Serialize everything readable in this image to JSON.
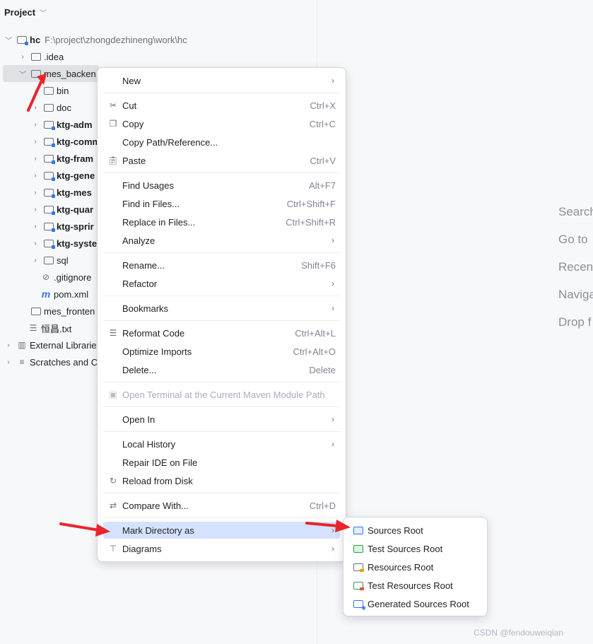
{
  "project_panel": {
    "title": "Project",
    "tree": [
      {
        "name": "hc",
        "path": "F:\\project\\zhongdezhineng\\work\\hc"
      },
      {
        "name": ".idea"
      },
      {
        "name": "mes_backen"
      },
      {
        "name": "bin"
      },
      {
        "name": "doc"
      },
      {
        "name": "ktg-adm"
      },
      {
        "name": "ktg-comm"
      },
      {
        "name": "ktg-fram"
      },
      {
        "name": "ktg-gene"
      },
      {
        "name": "ktg-mes"
      },
      {
        "name": "ktg-quar"
      },
      {
        "name": "ktg-sprir"
      },
      {
        "name": "ktg-syste"
      },
      {
        "name": "sql"
      },
      {
        "name": ".gitignore"
      },
      {
        "name": "pom.xml"
      },
      {
        "name": "mes_fronten"
      },
      {
        "name": "恒昌.txt"
      },
      {
        "name": "External Librarie"
      },
      {
        "name": "Scratches and C"
      }
    ]
  },
  "editor_hints": [
    "Search",
    "Go to",
    "Recent",
    "Naviga",
    "Drop f"
  ],
  "context_menu": {
    "items": [
      {
        "label": "New",
        "shortcut": ""
      },
      {
        "label": "Cut",
        "shortcut": "Ctrl+X"
      },
      {
        "label": "Copy",
        "shortcut": "Ctrl+C"
      },
      {
        "label": "Copy Path/Reference...",
        "shortcut": ""
      },
      {
        "label": "Paste",
        "shortcut": "Ctrl+V"
      },
      {
        "label": "Find Usages",
        "shortcut": "Alt+F7"
      },
      {
        "label": "Find in Files...",
        "shortcut": "Ctrl+Shift+F"
      },
      {
        "label": "Replace in Files...",
        "shortcut": "Ctrl+Shift+R"
      },
      {
        "label": "Analyze",
        "shortcut": ""
      },
      {
        "label": "Rename...",
        "shortcut": "Shift+F6"
      },
      {
        "label": "Refactor",
        "shortcut": ""
      },
      {
        "label": "Bookmarks",
        "shortcut": ""
      },
      {
        "label": "Reformat Code",
        "shortcut": "Ctrl+Alt+L"
      },
      {
        "label": "Optimize Imports",
        "shortcut": "Ctrl+Alt+O"
      },
      {
        "label": "Delete...",
        "shortcut": "Delete"
      },
      {
        "label": "Open Terminal at the Current Maven Module Path",
        "shortcut": ""
      },
      {
        "label": "Open In",
        "shortcut": ""
      },
      {
        "label": "Local History",
        "shortcut": ""
      },
      {
        "label": "Repair IDE on File",
        "shortcut": ""
      },
      {
        "label": "Reload from Disk",
        "shortcut": ""
      },
      {
        "label": "Compare With...",
        "shortcut": "Ctrl+D"
      },
      {
        "label": "Mark Directory as",
        "shortcut": ""
      },
      {
        "label": "Diagrams",
        "shortcut": ""
      }
    ]
  },
  "submenu": {
    "items": [
      {
        "label": "Sources Root"
      },
      {
        "label": "Test Sources Root"
      },
      {
        "label": "Resources Root"
      },
      {
        "label": "Test Resources Root"
      },
      {
        "label": "Generated Sources Root"
      }
    ]
  },
  "watermark": "CSDN @fendouweiqian",
  "colors": {
    "accent": "#3574f0",
    "highlight": "#d4e2ff",
    "annotation_arrow": "#e8252b"
  }
}
